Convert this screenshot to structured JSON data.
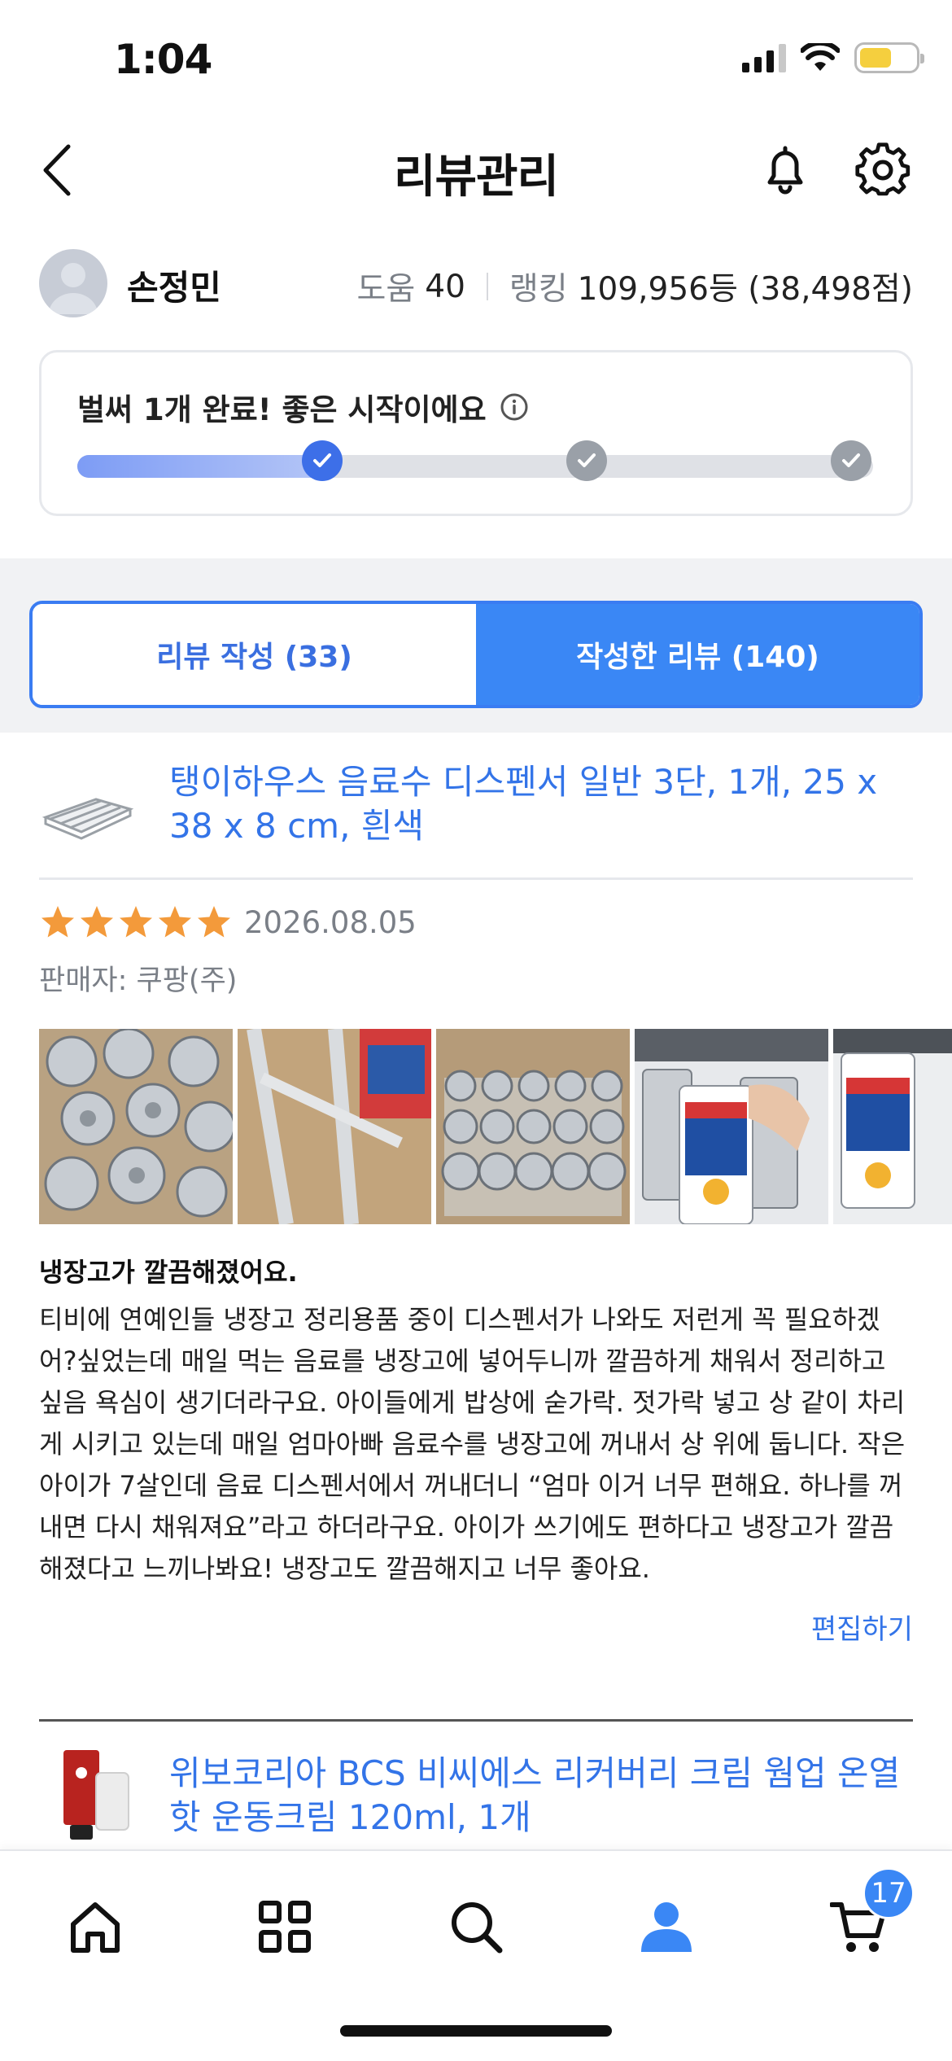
{
  "status_bar": {
    "time": "1:04"
  },
  "header": {
    "title": "리뷰관리"
  },
  "profile": {
    "name": "손정민",
    "help_label": "도움",
    "help_value": "40",
    "rank_label": "랭킹",
    "rank_value": "109,956등 (38,498점)"
  },
  "progress": {
    "title": "벌써 1개 완료! 좋은 시작이에요",
    "completed_steps": 1,
    "total_steps": 3,
    "fill_fraction": 0.33,
    "colors": {
      "fill": "#7d9cf5",
      "step_done": "#3d6fe8",
      "step_todo": "#9aa0a8"
    }
  },
  "tabs": [
    {
      "label": "리뷰 작성 (33)",
      "active": false
    },
    {
      "label": "작성한 리뷰 (140)",
      "active": true
    }
  ],
  "review": {
    "product_name": "탱이하우스 음료수 디스펜서 일반 3단, 1개, 25 x 38 x 8 cm, 흰색",
    "stars": 5,
    "date": "2026.08.05",
    "seller": "판매자: 쿠팡(주)",
    "photo_count_visible": 5,
    "headline": "냉장고가 깔끔해졌어요.",
    "body": "티비에 연예인들 냉장고 정리용품 중이 디스펜서가 나와도 저런게 꼭 필요하겠어?싶었는데 매일 먹는 음료를 냉장고에 넣어두니까 깔끔하게 채워서 정리하고 싶음 욕심이 생기더라구요. 아이들에게 밥상에 숟가락. 젓가락 넣고 상 같이 차리게 시키고 있는데 매일 엄마아빠 음료수를 냉장고에 꺼내서 상 위에 둡니다. 작은 아이가 7살인데 음료 디스펜서에서 꺼내더니 “엄마 이거 너무 편해요. 하나를 꺼내면 다시 채워져요”라고 하더라구요. 아이가 쓰기에도 편하다고 냉장고가 깔끔해졌다고 느끼나봐요! 냉장고도 깔끔해지고 너무 좋아요.",
    "edit_label": "편집하기"
  },
  "next_review": {
    "product_name": "위보코리아 BCS 비씨에스 리커버리 크림 웜업 온열핫 운동크림 120ml, 1개"
  },
  "bottom_nav": {
    "items": [
      {
        "icon": "home-icon"
      },
      {
        "icon": "grid-icon"
      },
      {
        "icon": "search-icon"
      },
      {
        "icon": "person-icon"
      },
      {
        "icon": "cart-icon"
      }
    ],
    "cart_badge": "17",
    "active_color": "#3a87f5"
  },
  "colors": {
    "accent": "#3a87f5",
    "link": "#3374e8",
    "star": "#f39a3b"
  }
}
